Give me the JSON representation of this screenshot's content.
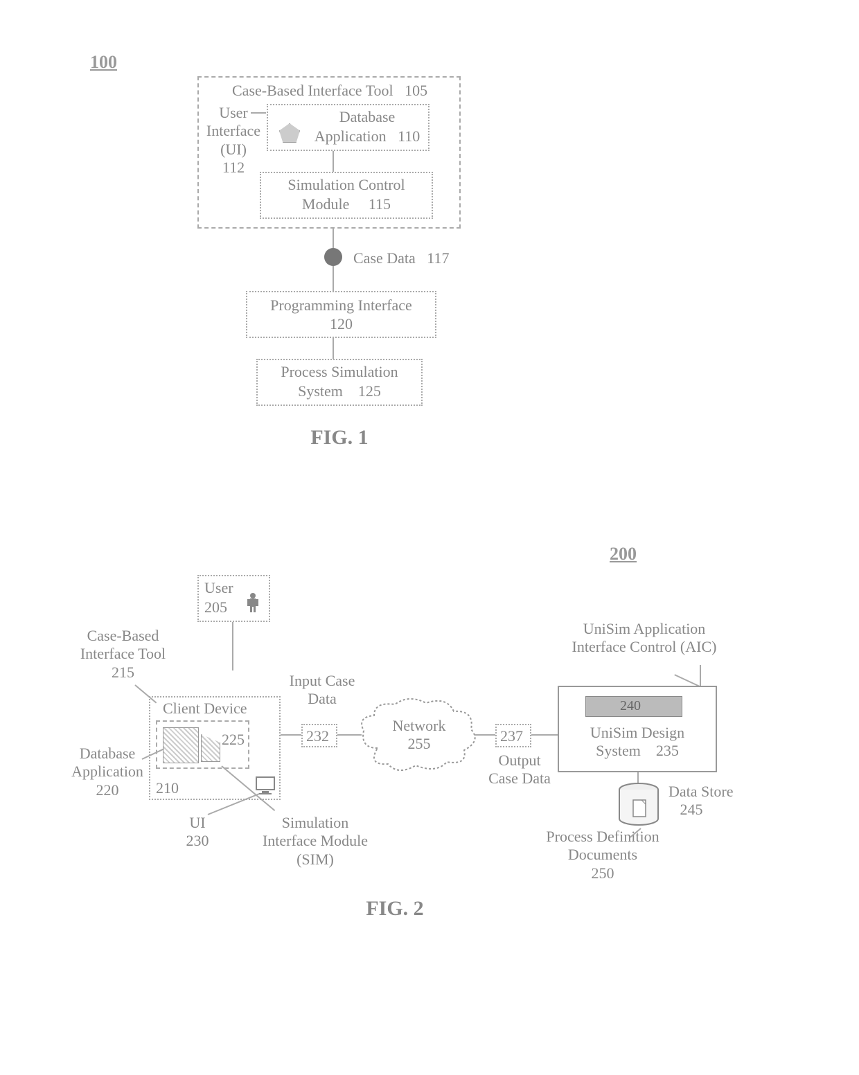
{
  "fig1": {
    "ref_num": "100",
    "caption": "FIG. 1",
    "tool_box": {
      "label": "Case-Based Interface Tool",
      "num": "105"
    },
    "ui_label": {
      "line1": "User",
      "line2": "Interface",
      "line3": "(UI)",
      "num": "112"
    },
    "db_app": {
      "line1": "Database",
      "line2": "Application",
      "num": "110"
    },
    "sim_ctrl": {
      "line1": "Simulation Control",
      "line2": "Module",
      "num": "115"
    },
    "case_data": {
      "label": "Case Data",
      "num": "117"
    },
    "prog_iface": {
      "line1": "Programming Interface",
      "num": "120"
    },
    "proc_sim": {
      "line1": "Process Simulation",
      "line2": "System",
      "num": "125"
    }
  },
  "fig2": {
    "ref_num": "200",
    "caption": "FIG. 2",
    "user": {
      "label": "User",
      "num": "205"
    },
    "client_device": {
      "label": "Client Device"
    },
    "client_num": "210",
    "cb_tool": {
      "line1": "Case-Based",
      "line2": "Interface Tool",
      "num": "215"
    },
    "db_app": {
      "line1": "Database",
      "line2": "Application",
      "num": "220"
    },
    "inner_num": "225",
    "ui": {
      "label": "UI",
      "num": "230"
    },
    "input_case": {
      "line1": "Input Case",
      "line2": "Data"
    },
    "sim_mod": {
      "line1": "Simulation",
      "line2": "Interface Module",
      "line3": "(SIM)"
    },
    "input_num": "232",
    "network": {
      "label": "Network",
      "num": "255"
    },
    "output_num": "237",
    "output_case": {
      "line1": "Output",
      "line2": "Case Data"
    },
    "unisim_aic": {
      "line1": "UniSim Application",
      "line2": "Interface Control (AIC)"
    },
    "aic_num": "240",
    "unisim_design": {
      "line1": "UniSim Design",
      "line2": "System",
      "num": "235"
    },
    "data_store": {
      "label": "Data Store",
      "num": "245"
    },
    "proc_def": {
      "line1": "Process Definition",
      "line2": "Documents",
      "num": "250"
    }
  }
}
